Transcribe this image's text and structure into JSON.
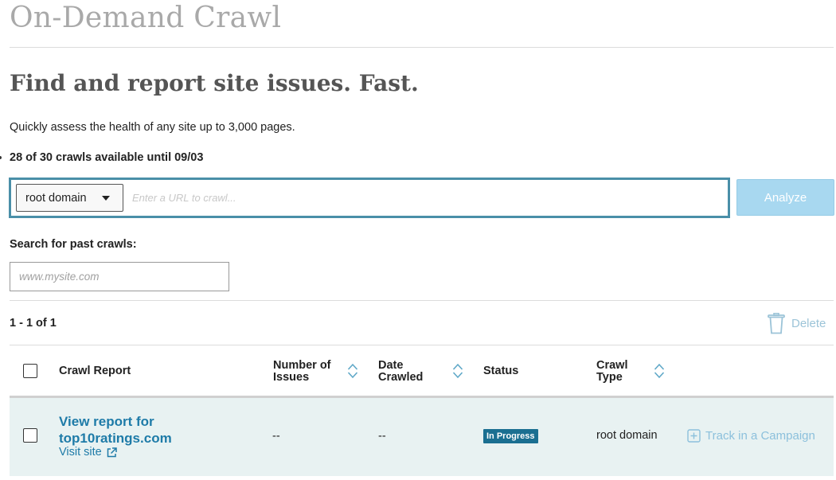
{
  "page": {
    "title": "On-Demand Crawl",
    "headline": "Find and report site issues. Fast.",
    "subtext": "Quickly assess the health of any site up to 3,000 pages.",
    "crawls_available": "28 of 30 crawls available until 09/03"
  },
  "crawl_form": {
    "domain_select_value": "root domain",
    "url_placeholder": "Enter a URL to crawl...",
    "analyze_label": "Analyze"
  },
  "search": {
    "label": "Search for past crawls:",
    "placeholder": "www.mysite.com"
  },
  "results": {
    "pager": "1 - 1 of 1",
    "delete_label": "Delete"
  },
  "table": {
    "columns": {
      "crawl_report": "Crawl Report",
      "issues_line1": "Number of",
      "issues_line2": "Issues",
      "date_line1": "Date",
      "date_line2": "Crawled",
      "status": "Status",
      "type_line1": "Crawl",
      "type_line2": "Type"
    },
    "rows": [
      {
        "report_line1": "View report for",
        "report_line2": "top10ratings.com",
        "visit_label": "Visit site",
        "issues": "--",
        "date": "--",
        "status": "In Progress",
        "crawl_type": "root domain",
        "track_label": "Track in a Campaign"
      }
    ]
  },
  "colors": {
    "accent_border": "#4a8fa8",
    "link": "#1e7ba8",
    "analyze_bg": "#a8d8f0",
    "status_badge_bg": "#1a6f91",
    "row_bg": "#e8f2f2"
  }
}
